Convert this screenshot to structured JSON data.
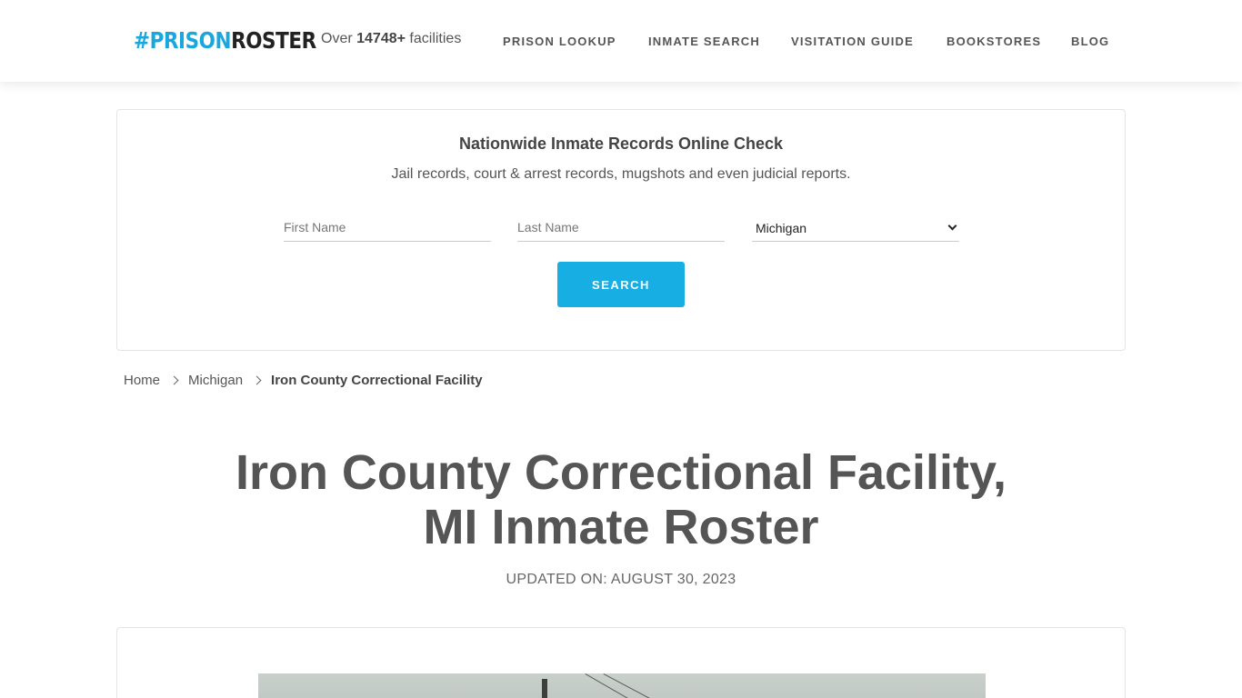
{
  "header": {
    "logo": {
      "hash": "#",
      "prison": "PRISON",
      "roster": "ROSTER"
    },
    "facility_count": {
      "prefix": "Over",
      "count": "14748+",
      "suffix": "facilities"
    },
    "nav": [
      {
        "label": "PRISON LOOKUP"
      },
      {
        "label": "INMATE SEARCH"
      },
      {
        "label": "VISITATION GUIDE"
      },
      {
        "label": "BOOKSTORES"
      },
      {
        "label": "BLOG"
      }
    ]
  },
  "search": {
    "title": "Nationwide Inmate Records Online Check",
    "subtitle": "Jail records, court & arrest records, mugshots and even judicial reports.",
    "first_name_placeholder": "First Name",
    "last_name_placeholder": "Last Name",
    "state_value": "Michigan",
    "button_label": "SEARCH"
  },
  "breadcrumb": {
    "home": "Home",
    "state": "Michigan",
    "current": "Iron County Correctional Facility"
  },
  "page": {
    "title_line1": "Iron County Correctional Facility,",
    "title_line2": "MI Inmate Roster",
    "updated": "UPDATED ON: AUGUST 30, 2023"
  },
  "colors": {
    "brand_blue": "#1aa7dd",
    "button_blue": "#16aee3",
    "text_dark": "#555555"
  }
}
